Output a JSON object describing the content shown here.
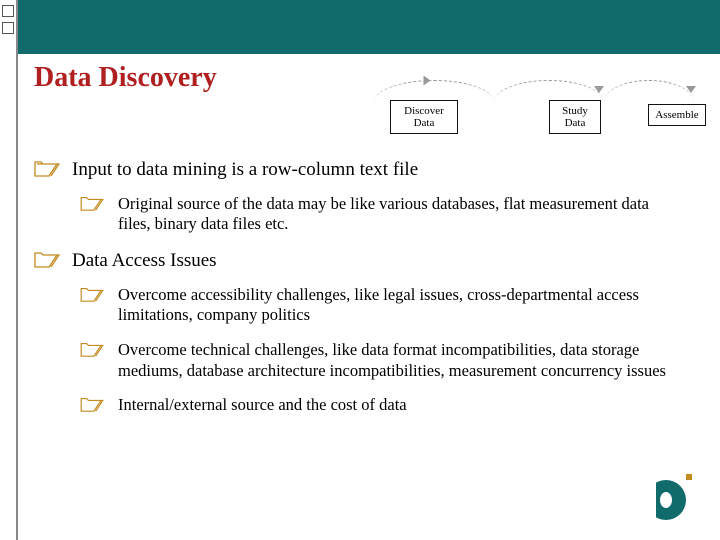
{
  "title": "Data Discovery",
  "diagram": {
    "box1_line1": "Discover",
    "box1_line2": "Data",
    "box2_line1": "Study",
    "box2_line2": "Data",
    "box3": "Assemble"
  },
  "bullets": {
    "b1": "Input to data mining is a row-column text file",
    "b1_1": "Original source of the data may be like various databases, flat measurement data files, binary data files etc.",
    "b2": "Data Access Issues",
    "b2_1": "Overcome accessibility challenges, like legal issues, cross-departmental access limitations, company politics",
    "b2_2": "Overcome technical challenges, like data format incompatibilities,  data storage mediums, database architecture incompatibilities, measurement concurrency issues",
    "b2_3": "Internal/external source and the cost of data"
  },
  "colors": {
    "teal": "#116b6b",
    "title_red": "#b02020",
    "folder_stroke": "#c28a1f"
  }
}
